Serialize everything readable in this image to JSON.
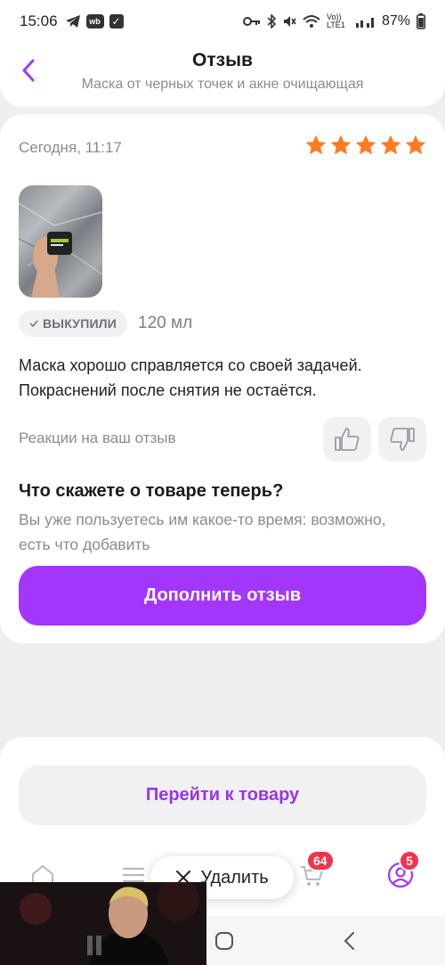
{
  "status_bar": {
    "time": "15:06",
    "wb_badge": "wb",
    "battery": "87%",
    "network": "Vo)) LTE1"
  },
  "header": {
    "title": "Отзыв",
    "subtitle": "Маска от черных точек и акне очищающая",
    "back_icon": "chevron-left-icon"
  },
  "review": {
    "date": "Сегодня, 11:17",
    "rating": 5,
    "rating_max": 5,
    "star_color": "#ff7b21",
    "bought_badge": "ВЫКУПИЛИ",
    "size": "120 мл",
    "text": "Маска хорошо справляется со своей задачей. Покраснений после снятия не остаётся.",
    "reactions_label": "Реакции на ваш отзыв"
  },
  "prompt": {
    "title": "Что скажете о товаре теперь?",
    "subtitle": "Вы уже пользуетесь им какое-то время: возможно, есть что добавить"
  },
  "buttons": {
    "add_review": "Дополнить отзыв",
    "go_to_product": "Перейти к товару",
    "delete": "Удалить"
  },
  "tabbar": {
    "cart_count": "64",
    "profile_count": "5"
  },
  "colors": {
    "accent": "#a336fb",
    "secondary_text_accent": "#9a34e6",
    "badge_red": "#f0334e"
  }
}
